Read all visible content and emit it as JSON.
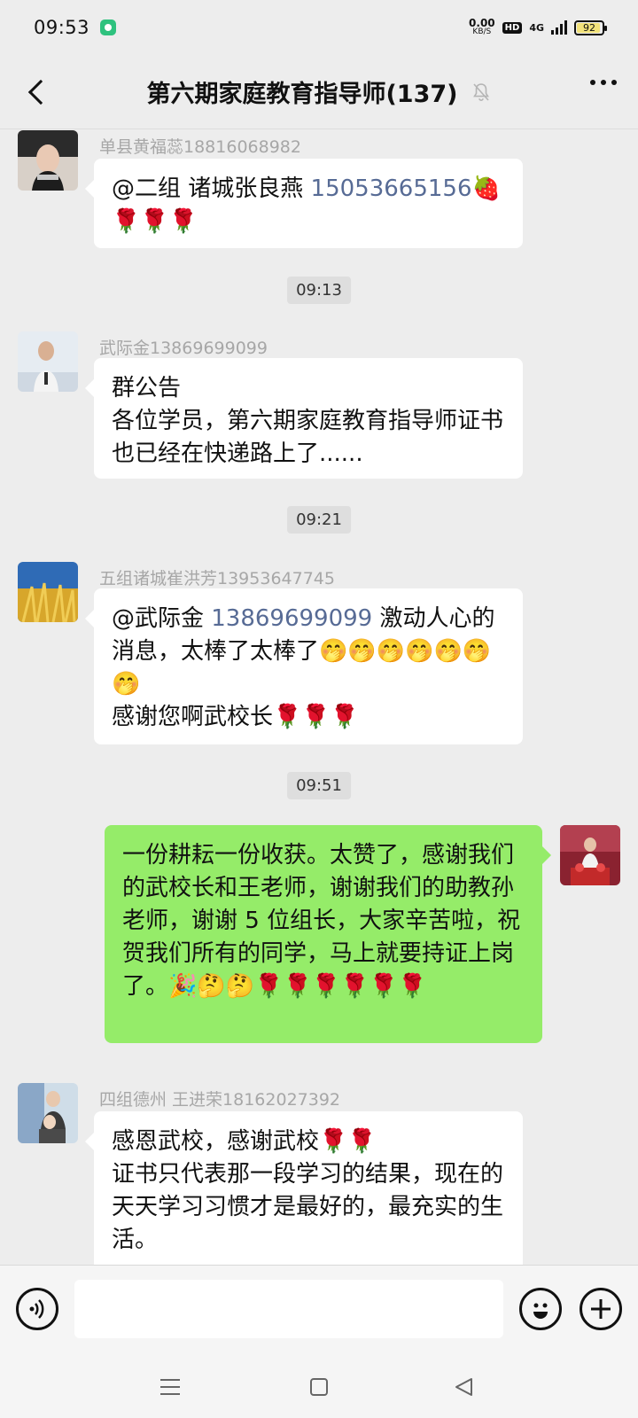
{
  "status_bar": {
    "time": "09:53",
    "net_speed_value": "0.00",
    "net_speed_unit": "KB/S",
    "hd_label": "HD",
    "network_type": "4G",
    "battery_level": "92"
  },
  "header": {
    "title": "第六期家庭教育指导师(137)"
  },
  "messages": [
    {
      "sender": "单县黄福蕊18816068982",
      "prefix": "@二组 诸城张良燕 ",
      "phone": "15053665156",
      "suffix": "🍓\n🌹🌹🌹"
    },
    {
      "sender": "武际金13869699099",
      "text": "群公告\n各位学员，第六期家庭教育指导师证书也已经在快递路上了......"
    },
    {
      "sender": "五组诸城崔洪芳13953647745",
      "prefix": "@武际金 ",
      "phone": "13869699099",
      "suffix": " 激动人心的消息，太棒了太棒了🤭🤭🤭🤭🤭🤭🤭\n感谢您啊武校长🌹🌹🌹"
    },
    {
      "text": "一份耕耘一份收获。太赞了，感谢我们的武校长和王老师，谢谢我们的助教孙老师，谢谢 5 位组长，大家辛苦啦，祝贺我们所有的同学，马上就要持证上岗了。🎉🤔🤔🌹🌹🌹🌹🌹🌹"
    },
    {
      "sender": "四组德州 王进荣18162027392",
      "text": "感恩武校，感谢武校🌹🌹\n证书只代表那一段学习的结果，现在的天天学习习惯才是最好的，最充实的生活。"
    }
  ],
  "timestamps": [
    "09:13",
    "09:21",
    "09:51"
  ],
  "colors": {
    "background": "#ededed",
    "self_bubble": "#95ec69",
    "other_bubble": "#ffffff",
    "mention_link": "#576b95"
  }
}
